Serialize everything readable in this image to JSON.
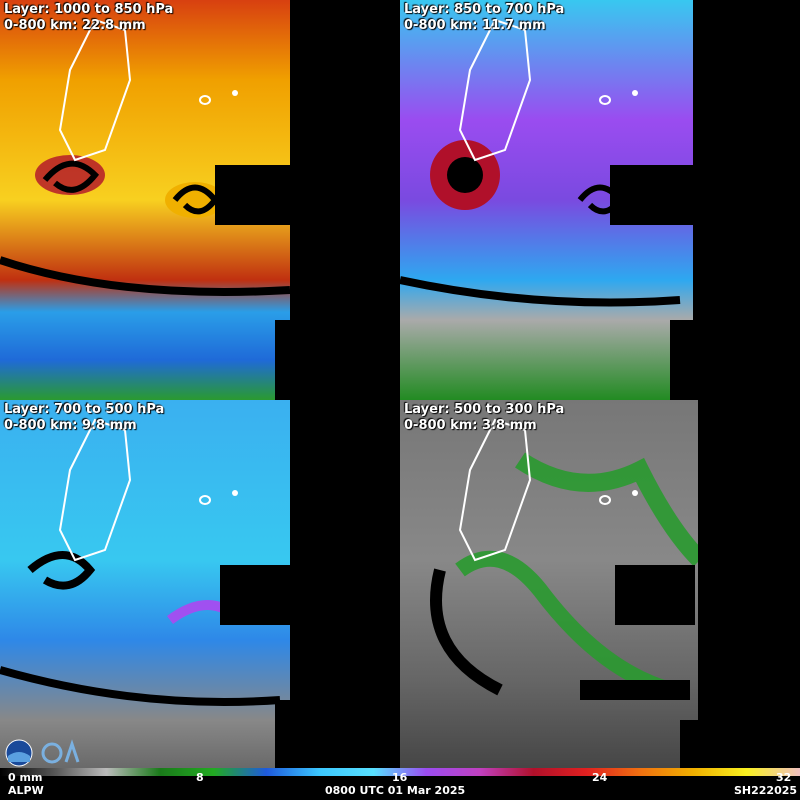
{
  "panels": [
    {
      "layer": "Layer: 1000 to 850 hPa",
      "mean": "0-800 km: 22.8 mm",
      "palette": "warm"
    },
    {
      "layer": "Layer: 850 to 700 hPa",
      "mean": "0-800 km: 11.7 mm",
      "palette": "cool"
    },
    {
      "layer": "Layer: 700 to 500 hPa",
      "mean": "0-800 km: 9.8 mm",
      "palette": "blue"
    },
    {
      "layer": "Layer: 500 to 300 hPa",
      "mean": "0-800 km: 3.8 mm",
      "palette": "dry"
    }
  ],
  "colorbar": {
    "ticks": [
      "0 mm",
      "8",
      "16",
      "24",
      "32"
    ],
    "colors": [
      "#000000",
      "#555555",
      "#bbbbbb",
      "#1a7a1a",
      "#22aa22",
      "#1e5adc",
      "#3cc8ff",
      "#58e0ff",
      "#9a4cf0",
      "#c040c0",
      "#b0102a",
      "#e02020",
      "#f07010",
      "#f0b000",
      "#f8f020",
      "#f0c0c0"
    ]
  },
  "footer": {
    "product": "ALPW",
    "time": "0800 UTC 01 Mar 2025",
    "storm_id": "SH222025"
  },
  "logos": [
    "noaa-logo",
    "cira-logo"
  ]
}
